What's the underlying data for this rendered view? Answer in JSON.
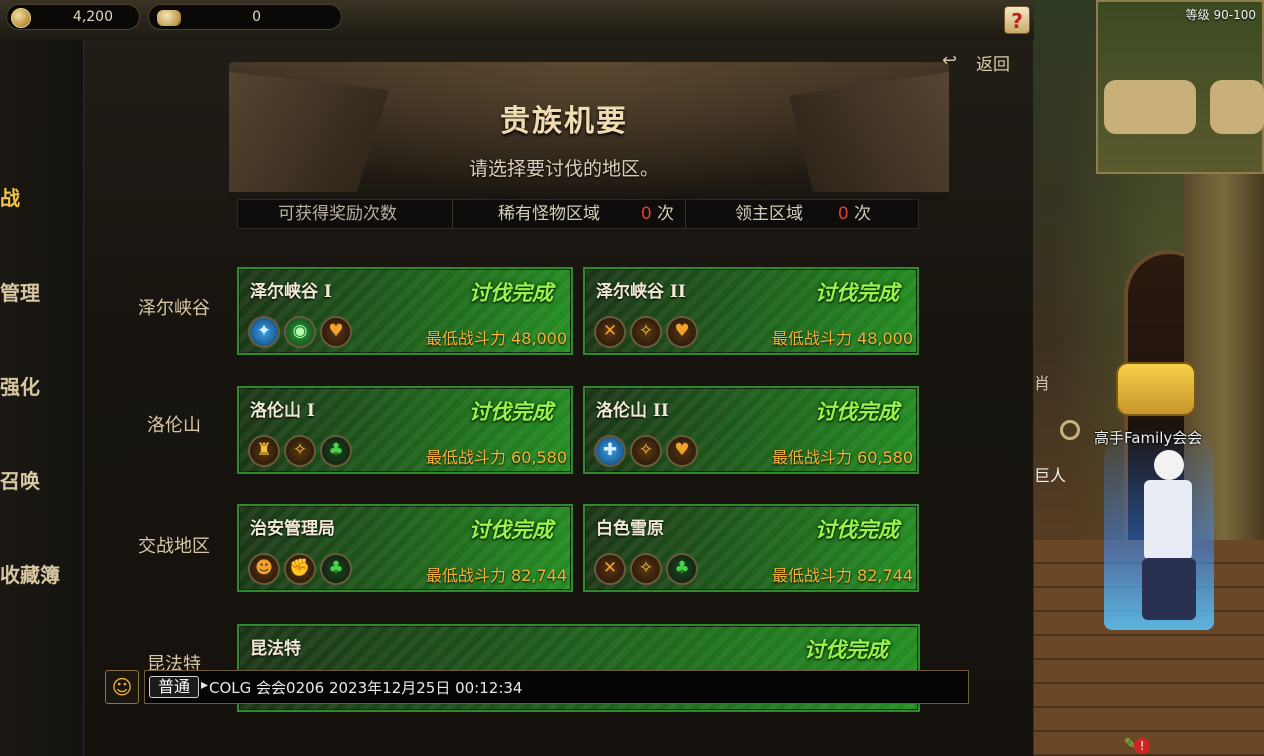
{
  "currency": {
    "gold": "4,200",
    "coins": "0"
  },
  "help_label": "?",
  "nav": {
    "items": [
      {
        "label": "战",
        "active": true
      },
      {
        "label": "管理"
      },
      {
        "label": "强化"
      },
      {
        "label": "召唤"
      },
      {
        "label": "收藏簿"
      }
    ]
  },
  "header": {
    "return_label": "返回",
    "return_icon": "↩",
    "title": "贵族机要",
    "subtitle": "请选择要讨伐的地区。"
  },
  "rewards": {
    "label": "可获得奖励次数",
    "rare_label": "稀有怪物区域",
    "rare_count": "0",
    "lord_label": "领主区域",
    "lord_count": "0",
    "unit": "次"
  },
  "regions": [
    {
      "name": "泽尔峡谷",
      "cards": [
        {
          "name": "泽尔峡谷 I",
          "status": "讨伐完成",
          "power_label": "最低战斗力",
          "power": "48,000",
          "icons": [
            "blue-slash-icon",
            "green-eye-icon",
            "orange-heart-icon"
          ]
        },
        {
          "name": "泽尔峡谷 II",
          "status": "讨伐完成",
          "power_label": "最低战斗力",
          "power": "48,000",
          "icons": [
            "orange-cross-icon",
            "orange-torch-icon",
            "orange-heart-icon"
          ]
        }
      ]
    },
    {
      "name": "洛伦山",
      "cards": [
        {
          "name": "洛伦山 I",
          "status": "讨伐完成",
          "power_label": "最低战斗力",
          "power": "60,580",
          "icons": [
            "orange-body-icon",
            "orange-torch-icon",
            "green-clover-icon"
          ]
        },
        {
          "name": "洛伦山 II",
          "status": "讨伐完成",
          "power_label": "最低战斗力",
          "power": "60,580",
          "icons": [
            "blue-cross-icon",
            "orange-torch-icon",
            "orange-heart-icon"
          ]
        }
      ]
    },
    {
      "name": "交战地区",
      "cards": [
        {
          "name": "治安管理局",
          "status": "讨伐完成",
          "power_label": "最低战斗力",
          "power": "82,744",
          "icons": [
            "orange-face-icon",
            "gold-fist-icon",
            "green-clover-icon"
          ]
        },
        {
          "name": "白色雪原",
          "status": "讨伐完成",
          "power_label": "最低战斗力",
          "power": "82,744",
          "icons": [
            "orange-cross-icon",
            "orange-torch-icon",
            "green-clover-icon"
          ]
        }
      ]
    },
    {
      "name": "昆法特",
      "cards": [
        {
          "name": "昆法特",
          "status": "讨伐完成"
        }
      ]
    }
  ],
  "chat": {
    "channel": "普通",
    "arrow": "▸",
    "message": "COLG 会会0206 2023年12月25日 00:12:34"
  },
  "scene": {
    "level_text": "等级 90-100",
    "guild_text": "高手Family会会",
    "sign_text": "肖",
    "sign2_text": "巨人"
  }
}
